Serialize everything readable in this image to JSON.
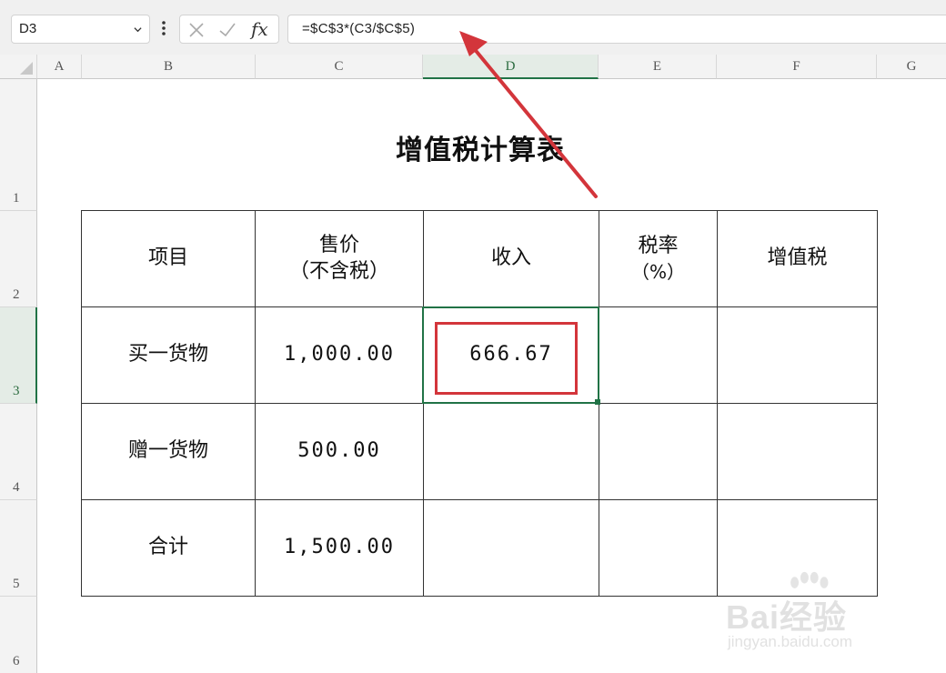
{
  "formula_bar": {
    "name_box": "D3",
    "formula": "=$C$3*(C3/$C$5)",
    "fx_label": "fx"
  },
  "columns": [
    "A",
    "B",
    "C",
    "D",
    "E",
    "F",
    "G"
  ],
  "rows": [
    "1",
    "2",
    "3",
    "4",
    "5",
    "6"
  ],
  "sheet": {
    "title": "增值税计算表",
    "headers": {
      "item": "项目",
      "price_line1": "售价",
      "price_line2": "（不含税）",
      "income": "收入",
      "rate_line1": "税率",
      "rate_line2": "（%）",
      "vat": "增值税"
    },
    "rows": [
      {
        "item": "买一货物",
        "price": "1,000.00",
        "income": "666.67"
      },
      {
        "item": "赠一货物",
        "price": "500.00",
        "income": ""
      },
      {
        "item": "合计",
        "price": "1,500.00",
        "income": ""
      }
    ]
  },
  "watermark": {
    "brand": "Bai经验",
    "sub": "jingyan.baidu.com"
  },
  "colors": {
    "selection": "#217346",
    "highlight": "#d3353b"
  }
}
